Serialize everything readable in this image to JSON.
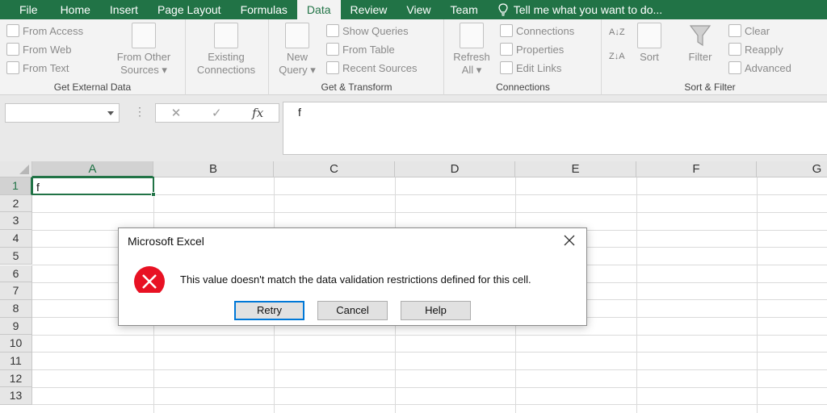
{
  "tabs": [
    {
      "label": "File",
      "active": false
    },
    {
      "label": "Home",
      "active": false
    },
    {
      "label": "Insert",
      "active": false
    },
    {
      "label": "Page Layout",
      "active": false
    },
    {
      "label": "Formulas",
      "active": false
    },
    {
      "label": "Data",
      "active": true
    },
    {
      "label": "Review",
      "active": false
    },
    {
      "label": "View",
      "active": false
    },
    {
      "label": "Team",
      "active": false
    }
  ],
  "tell_me": "Tell me what you want to do...",
  "ribbon": {
    "get_external": {
      "label": "Get External Data",
      "from_access": "From Access",
      "from_web": "From Web",
      "from_text": "From Text",
      "from_other_1": "From Other",
      "from_other_2": "Sources ▾",
      "existing_1": "Existing",
      "existing_2": "Connections"
    },
    "get_transform": {
      "label": "Get & Transform",
      "new_query_1": "New",
      "new_query_2": "Query ▾",
      "show_queries": "Show Queries",
      "from_table": "From Table",
      "recent_sources": "Recent Sources"
    },
    "connections": {
      "label": "Connections",
      "refresh_1": "Refresh",
      "refresh_2": "All ▾",
      "connections": "Connections",
      "properties": "Properties",
      "edit_links": "Edit Links"
    },
    "sort_filter": {
      "label": "Sort & Filter",
      "sort": "Sort",
      "filter": "Filter",
      "clear": "Clear",
      "reapply": "Reapply",
      "advanced": "Advanced"
    }
  },
  "formula_bar": {
    "name_box": "",
    "cancel": "✕",
    "enter": "✓",
    "fx": "fx",
    "value": "f"
  },
  "columns": [
    "A",
    "B",
    "C",
    "D",
    "E",
    "F",
    "G"
  ],
  "rows": [
    "1",
    "2",
    "3",
    "4",
    "5",
    "6",
    "7",
    "8",
    "9",
    "10",
    "11",
    "12",
    "13"
  ],
  "cell_a1": "f",
  "dialog": {
    "title": "Microsoft Excel",
    "message": "This value doesn't match the data validation restrictions defined for this cell.",
    "retry": "Retry",
    "cancel": "Cancel",
    "help": "Help"
  },
  "colors": {
    "accent": "#217346",
    "error": "#e81123",
    "focus": "#0078d7"
  }
}
